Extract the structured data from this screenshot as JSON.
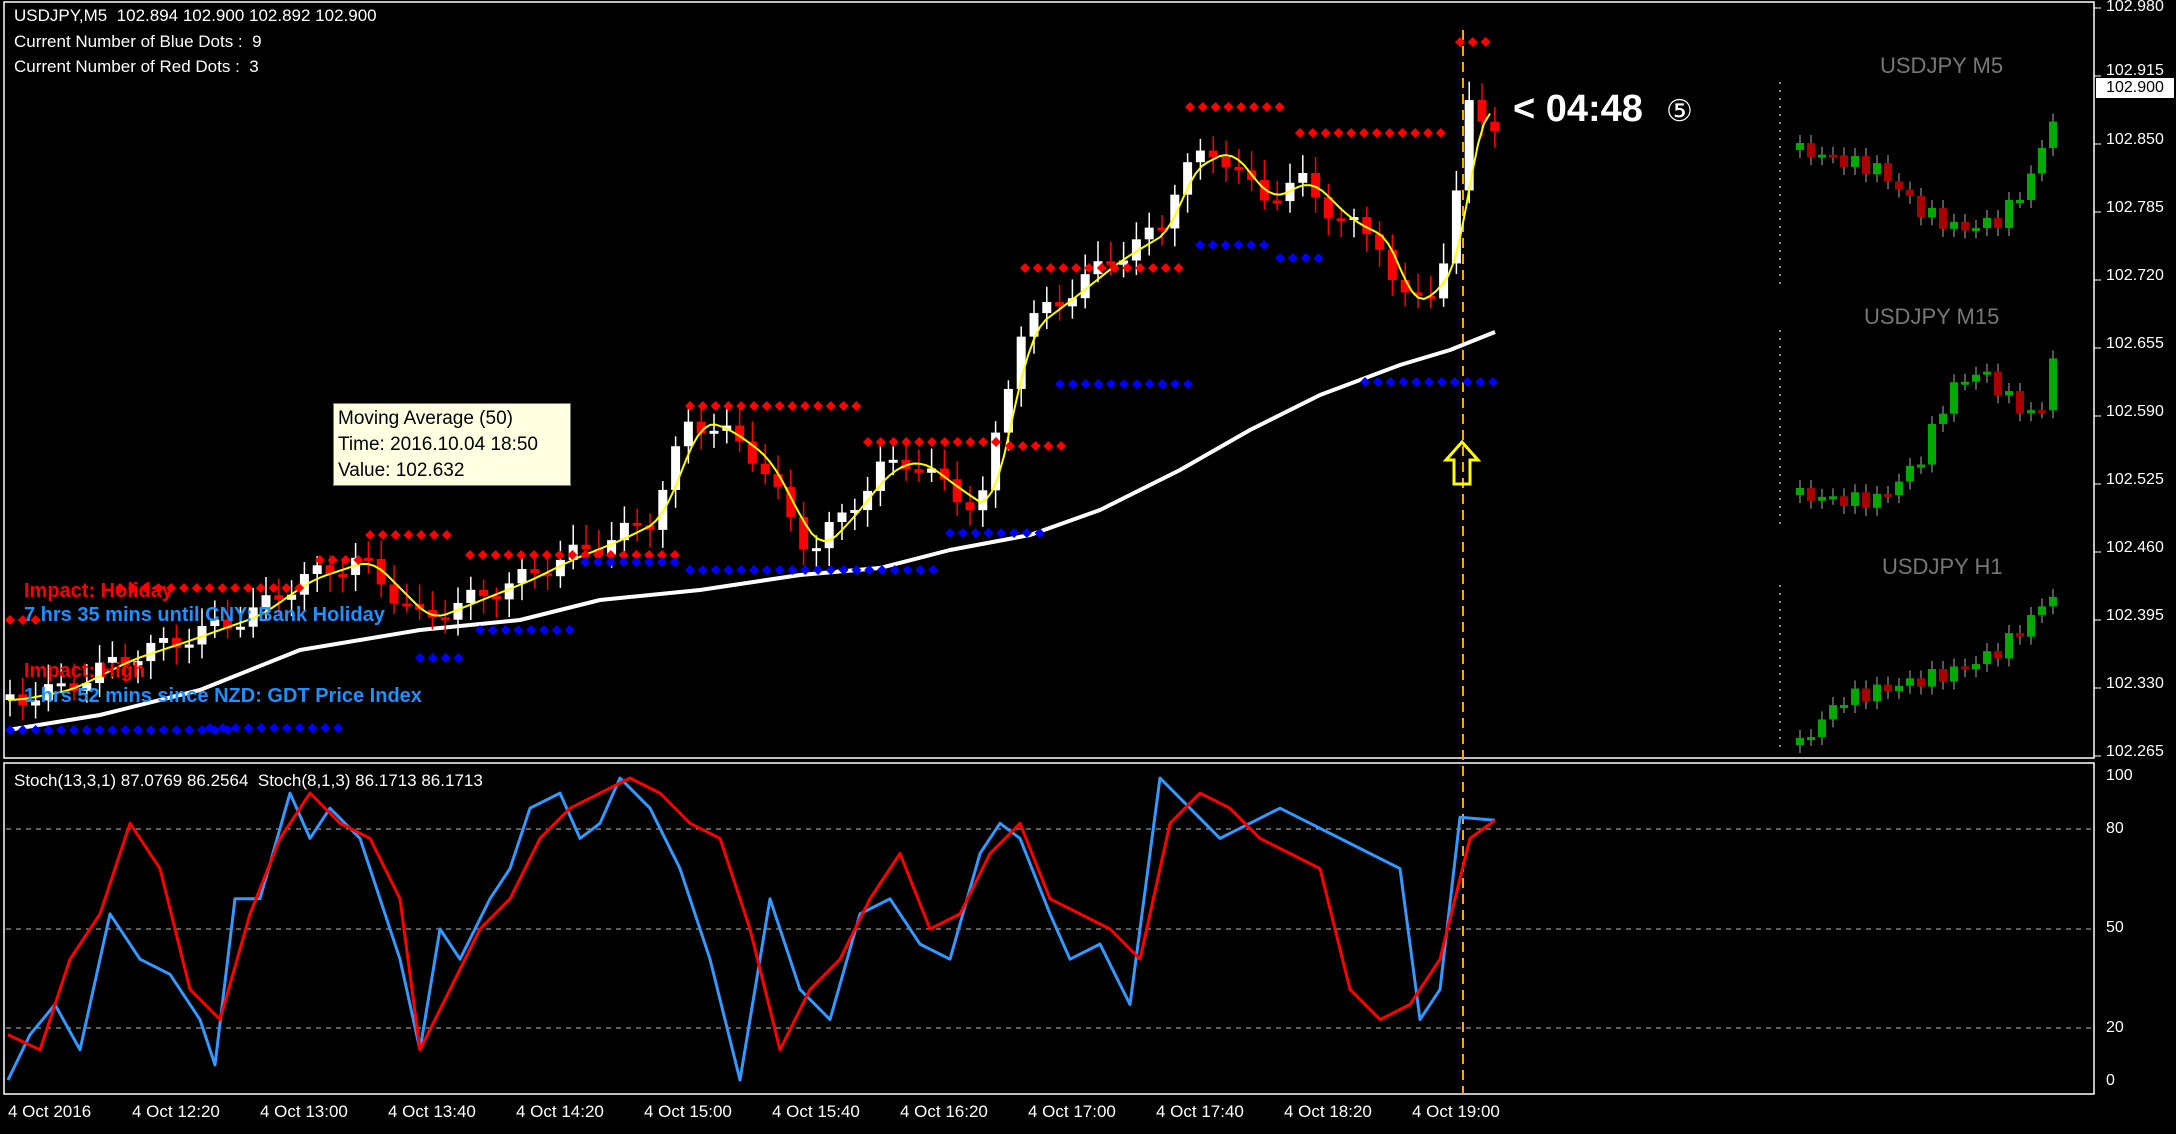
{
  "header": {
    "symbol_line": "USDJPY,M5  102.894 102.900 102.892 102.900",
    "blue_dots_label": "Current Number of Blue Dots :  9",
    "red_dots_label": "Current Number of Red Dots :  3"
  },
  "news": [
    {
      "label": "Impact: Holiday",
      "color": "#ff0000"
    },
    {
      "label": "7 hrs 35 mins until CNY: Bank Holiday",
      "color": "#1e90ff"
    },
    {
      "label": "Impact: High",
      "color": "#ff0000"
    },
    {
      "label": "1 hrs 52 mins since NZD: GDT Price Index",
      "color": "#1e90ff"
    }
  ],
  "tooltip": {
    "line1": "Moving Average (50)",
    "line2": "Time: 2016.10.04 18:50",
    "line3": "Value: 102.632"
  },
  "countdown": {
    "text": "< 04:48",
    "symbol": "⑤"
  },
  "mini_charts": [
    {
      "title": "USDJPY M5"
    },
    {
      "title": "USDJPY M15"
    },
    {
      "title": "USDJPY H1"
    }
  ],
  "price_axis": {
    "labels": [
      "102.980",
      "102.915",
      "102.850",
      "102.785",
      "102.720",
      "102.655",
      "102.590",
      "102.525",
      "102.460",
      "102.395",
      "102.330",
      "102.265"
    ],
    "current_price": "102.900"
  },
  "stoch": {
    "header": "Stoch(13,3,1) 87.0769 86.2564  Stoch(8,1,3) 86.1713 86.1713",
    "levels": [
      "100",
      "80",
      "50",
      "20",
      "0"
    ]
  },
  "time_axis": {
    "labels": [
      "4 Oct 2016",
      "4 Oct 12:20",
      "4 Oct 13:00",
      "4 Oct 13:40",
      "4 Oct 14:20",
      "4 Oct 15:00",
      "4 Oct 15:40",
      "4 Oct 16:20",
      "4 Oct 17:00",
      "4 Oct 17:40",
      "4 Oct 18:20",
      "4 Oct 19:00"
    ]
  },
  "colors": {
    "bull_candle": "#ffffff",
    "bear_candle": "#ff0000",
    "blue_dots": "#0000ff",
    "red_dots": "#ff0000",
    "fast_ma": "#ffff00",
    "slow_ma": "#ffffff",
    "stoch_fast": "#3399ff",
    "stoch_slow": "#ff0000",
    "mini_bull": "#00aa00",
    "mini_bear": "#aa0000",
    "vline": "#ffa500",
    "arrow": "#ffff00"
  },
  "icons": {
    "arrow": "up-arrow-icon"
  }
}
